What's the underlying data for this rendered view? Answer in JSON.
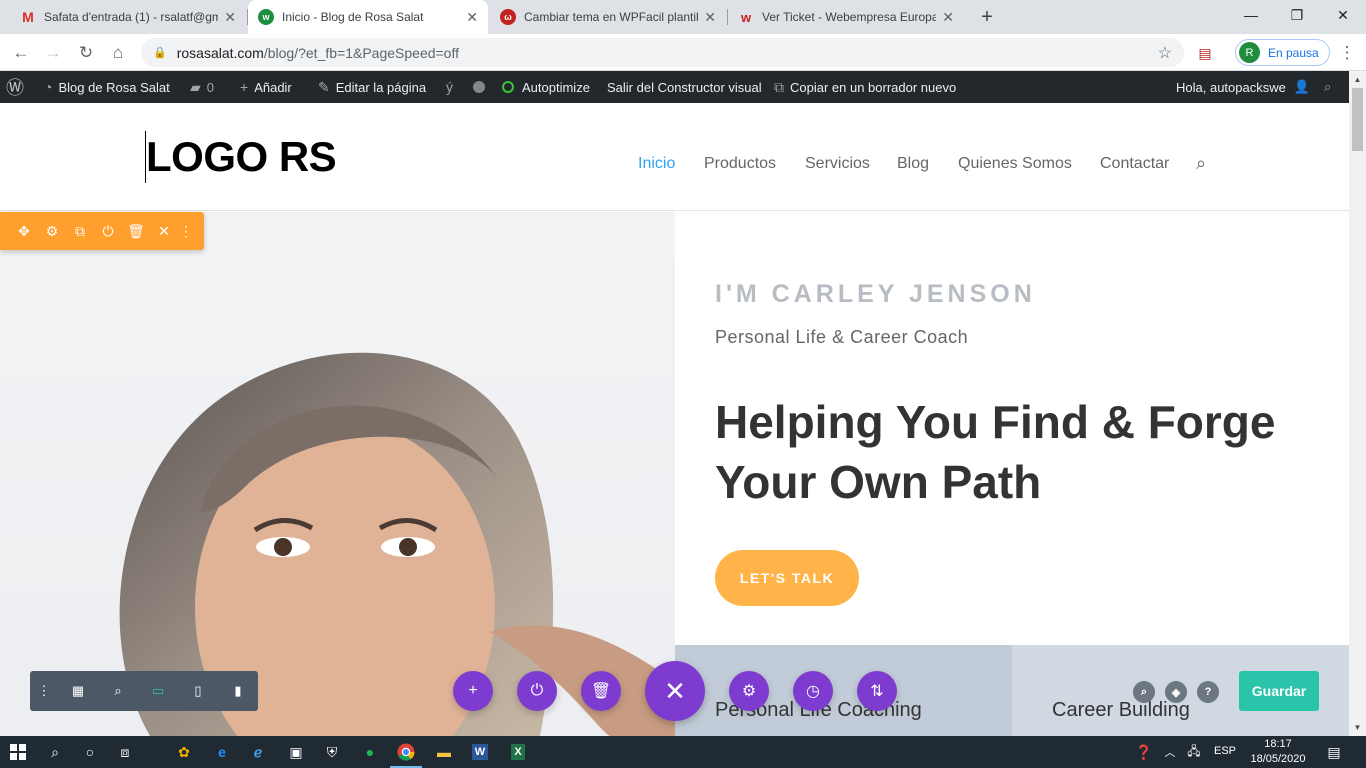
{
  "browser": {
    "tabs": [
      {
        "title": "Safata d'entrada (1) - rsalatf@gm",
        "favicon": "gmail-icon",
        "color": "#d93025",
        "active": false
      },
      {
        "title": "Inicio - Blog de Rosa Salat",
        "favicon": "webempresa-icon",
        "color": "#1e8e3e",
        "active": true
      },
      {
        "title": "Cambiar tema en WPFacil plantill",
        "favicon": "wpfacil-icon",
        "color": "#c5221f",
        "active": false
      },
      {
        "title": "Ver Ticket - Webempresa Europa",
        "favicon": "webempresa-w-icon",
        "color": "#c5221f",
        "active": false
      }
    ],
    "close_glyph": "✕",
    "new_tab_glyph": "+",
    "url_domain": "rosasalat.com",
    "url_path": "/blog/?et_fb=1&PageSpeed=off",
    "profile_initial": "R",
    "profile_status": "En pausa"
  },
  "adminbar": {
    "site_name": "Blog de Rosa Salat",
    "comments_count": "0",
    "add_new": "Añadir",
    "edit_page": "Editar la página",
    "autoptimize": "Autoptimize",
    "exit_builder": "Salir del Constructor visual",
    "copy_draft": "Copiar en un borrador nuevo",
    "greeting": "Hola, autopackswe"
  },
  "site": {
    "logo": "LOGO RS",
    "menu": [
      {
        "label": "Inicio",
        "active": true
      },
      {
        "label": "Productos",
        "active": false
      },
      {
        "label": "Servicios",
        "active": false
      },
      {
        "label": "Blog",
        "active": false
      },
      {
        "label": "Quienes Somos",
        "active": false
      },
      {
        "label": "Contactar",
        "active": false
      }
    ]
  },
  "hero": {
    "eyebrow": "I'M CARLEY JENSON",
    "subtitle": "Personal Life & Career Coach",
    "headline": "Helping You Find & Forge Your Own Path",
    "cta": "LET'S TALK"
  },
  "services": [
    {
      "label": "Personal Life Coaching",
      "bg": "#c2ccd8"
    },
    {
      "label": "Career Building",
      "bg": "#d0d8e2"
    }
  ],
  "builder": {
    "save_label": "Guardar",
    "help_glyph": "?",
    "accent_purple": "#7e3bd0",
    "accent_orange": "#ff9f2e",
    "accent_green": "#29c4a9"
  },
  "taskbar": {
    "language": "ESP",
    "time": "18:17",
    "date": "18/05/2020"
  }
}
